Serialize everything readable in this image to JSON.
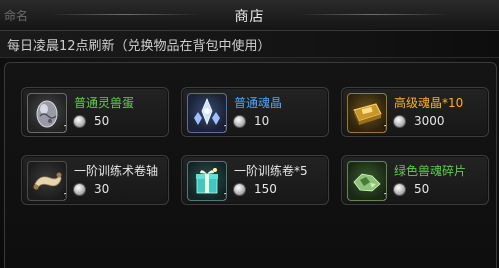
{
  "window": {
    "corner_text": "命名",
    "title": "商店"
  },
  "notice": "每日凌晨12点刷新（兑换物品在背包中使用）",
  "currency_icon": "silver-coin-icon",
  "items": [
    {
      "name": "普通灵兽蛋",
      "name_color": "#5fd04a",
      "quantity": "1",
      "price": "50",
      "icon": "beast-egg-icon"
    },
    {
      "name": "普通魂晶",
      "name_color": "#4aa6ff",
      "quantity": "1",
      "price": "10",
      "icon": "soul-crystal-icon"
    },
    {
      "name": "高级魂晶*10",
      "name_color": "#ffb020",
      "quantity": "1",
      "price": "3000",
      "icon": "gold-soul-crystal-icon"
    },
    {
      "name": "一阶训练术卷轴",
      "name_color": "#e6e6e6",
      "quantity": "1",
      "price": "30",
      "icon": "scroll-icon"
    },
    {
      "name": "一阶训练卷*5",
      "name_color": "#e6e6e6",
      "quantity": "1",
      "price": "150",
      "icon": "gift-box-icon"
    },
    {
      "name": "绿色兽魂碎片",
      "name_color": "#5fd04a",
      "quantity": "1",
      "price": "50",
      "icon": "green-beast-soul-shard-icon"
    }
  ]
}
